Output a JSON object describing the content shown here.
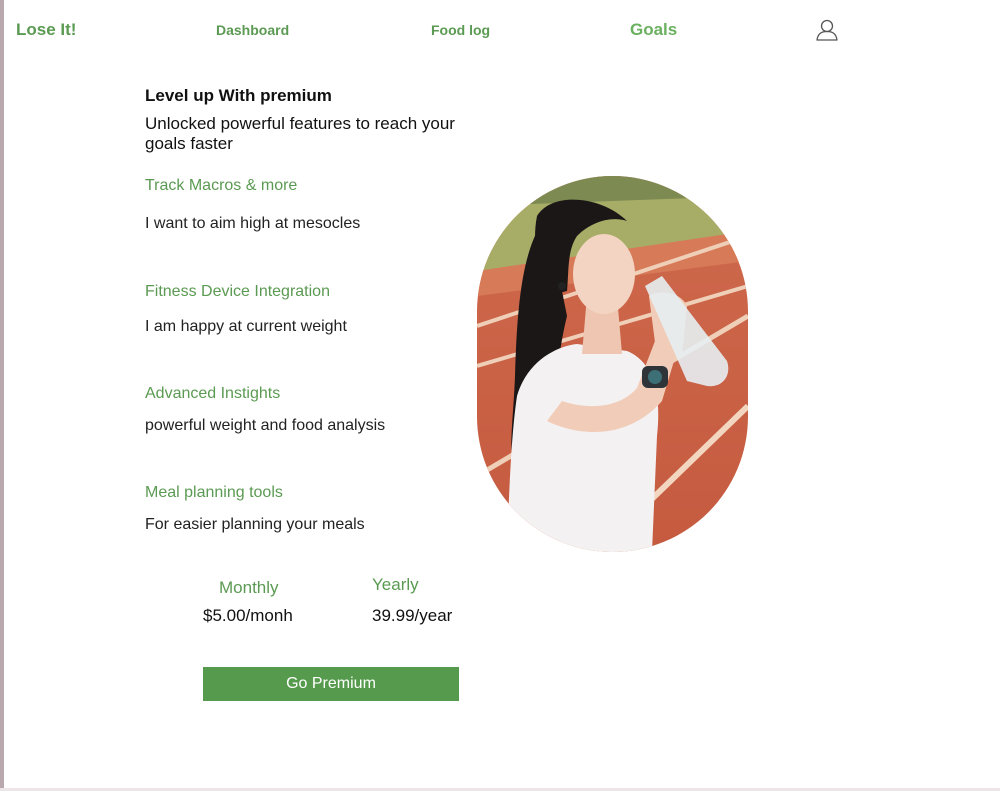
{
  "app": {
    "brand": "Lose It!"
  },
  "nav": {
    "dashboard": "Dashboard",
    "food_log": "Food log",
    "goals": "Goals",
    "profile_icon": "user-icon"
  },
  "promo": {
    "headline": "Level up With premium",
    "subhead": "Unlocked powerful features to reach your goals faster"
  },
  "features": [
    {
      "title": "Track Macros & more",
      "desc": "I want to aim high at mesocles"
    },
    {
      "title": "Fitness Device Integration",
      "desc": "I  am happy at current weight"
    },
    {
      "title": "Advanced Instights",
      "desc": "powerful weight and food analysis"
    },
    {
      "title": "Meal planning tools",
      "desc": "For easier planning your meals"
    }
  ],
  "plans": {
    "monthly": {
      "label": "Monthly",
      "price": "$5.00/monh"
    },
    "yearly": {
      "label": "Yearly",
      "price": "39.99/year"
    }
  },
  "cta": {
    "label": "Go Premium"
  },
  "colors": {
    "accent": "#569a4d",
    "accent_light": "#6ab05f",
    "text": "#111111"
  }
}
